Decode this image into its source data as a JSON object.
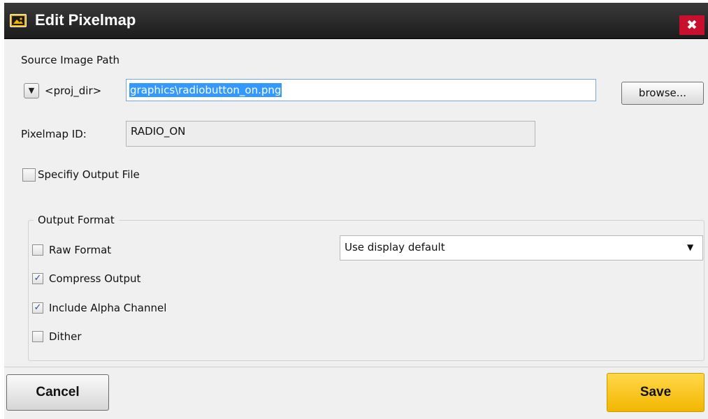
{
  "window": {
    "title": "Edit Pixelmap",
    "close_symbol": "✖",
    "icon": "image-icon",
    "colors": {
      "titlebar": "#262626",
      "close": "#c8102e",
      "accent": "#f2b600",
      "selection": "#3399ff"
    }
  },
  "source": {
    "label": "Source Image Path",
    "dropdown_symbol": "▼",
    "prefix": "<proj_dir>",
    "path_value": "graphics\\radiobutton_on.png",
    "browse_label": "browse..."
  },
  "pixelmap": {
    "label": "Pixelmap ID:",
    "value": "RADIO_ON"
  },
  "specify_output": {
    "label": "Specifiy Output File",
    "checked": false
  },
  "output_format": {
    "legend": "Output Format",
    "raw_format": {
      "label": "Raw Format",
      "checked": false
    },
    "compress": {
      "label": "Compress Output",
      "checked": true,
      "mark": "✓"
    },
    "alpha": {
      "label": "Include Alpha Channel",
      "checked": true,
      "mark": "✓"
    },
    "dither": {
      "label": "Dither",
      "checked": false
    },
    "palette_select": {
      "value": "Use display default",
      "arrow": "▼"
    }
  },
  "footer": {
    "cancel_label": "Cancel",
    "save_label": "Save"
  }
}
